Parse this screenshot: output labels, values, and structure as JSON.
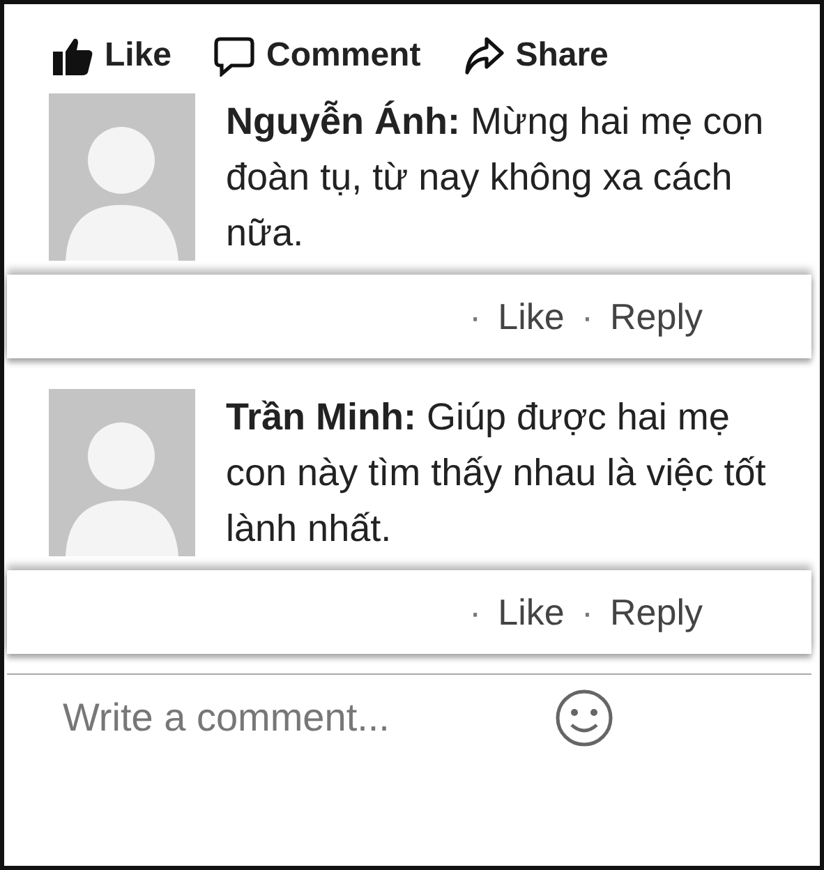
{
  "actions": [
    {
      "kind": "like",
      "label": "Like"
    },
    {
      "kind": "comment",
      "label": "Comment"
    },
    {
      "kind": "share",
      "label": "Share"
    }
  ],
  "comments": [
    {
      "text": "**Nguyễn Ánh:** Mừng hai mẹ con đoàn tụ, từ nay không xa cách nữa.",
      "links": [
        {
          "dot": "·",
          "label": "Like"
        },
        {
          "dot": "·",
          "label": "Reply"
        }
      ]
    },
    {
      "text": "**Trần Minh:** Giúp được hai mẹ con này tìm thấy nhau là việc tốt lành nhất.",
      "links": [
        {
          "dot": "·",
          "label": "Like"
        },
        {
          "dot": "·",
          "label": "Reply"
        }
      ]
    }
  ],
  "composer": {
    "placeholder": "Write a comment..."
  }
}
